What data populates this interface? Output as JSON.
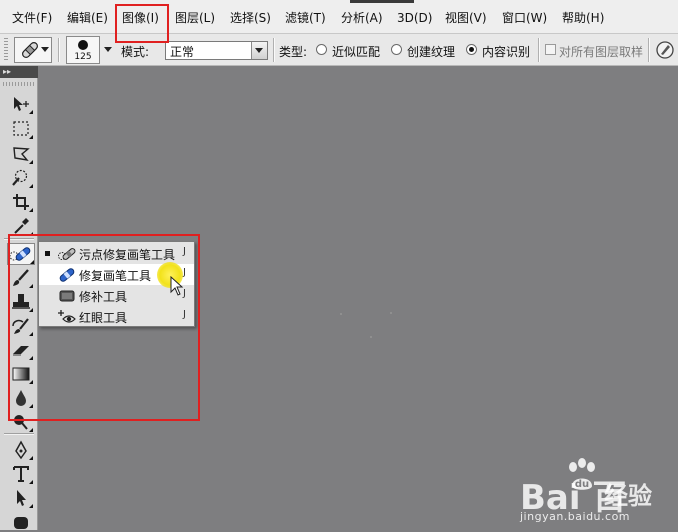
{
  "menubar": {
    "items": [
      {
        "label": "文件(F)"
      },
      {
        "label": "编辑(E)"
      },
      {
        "label": "图像(I)"
      },
      {
        "label": "图层(L)"
      },
      {
        "label": "选择(S)"
      },
      {
        "label": "滤镜(T)"
      },
      {
        "label": "分析(A)"
      },
      {
        "label": "3D(D)"
      },
      {
        "label": "视图(V)"
      },
      {
        "label": "窗口(W)"
      },
      {
        "label": "帮助(H)"
      }
    ]
  },
  "options": {
    "brush_size": "125",
    "mode_label": "模式:",
    "mode_value": "正常",
    "type_label": "类型:",
    "type_options": [
      {
        "label": "近似匹配",
        "checked": false
      },
      {
        "label": "创建纹理",
        "checked": false
      },
      {
        "label": "内容识别",
        "checked": true
      }
    ],
    "sample_all_label": "对所有图层取样"
  },
  "flyout": {
    "items": [
      {
        "label": "污点修复画笔工具",
        "key": "J",
        "current": true,
        "icon": "spot-healing-brush-icon"
      },
      {
        "label": "修复画笔工具",
        "key": "J",
        "current": false,
        "icon": "healing-brush-icon"
      },
      {
        "label": "修补工具",
        "key": "J",
        "current": false,
        "icon": "patch-icon"
      },
      {
        "label": "红眼工具",
        "key": "J",
        "current": false,
        "icon": "red-eye-icon"
      }
    ]
  },
  "highlight_color": "#e02020",
  "watermark": {
    "logo": "Bai  百",
    "text": "经验",
    "url": "jingyan.baidu.com"
  }
}
